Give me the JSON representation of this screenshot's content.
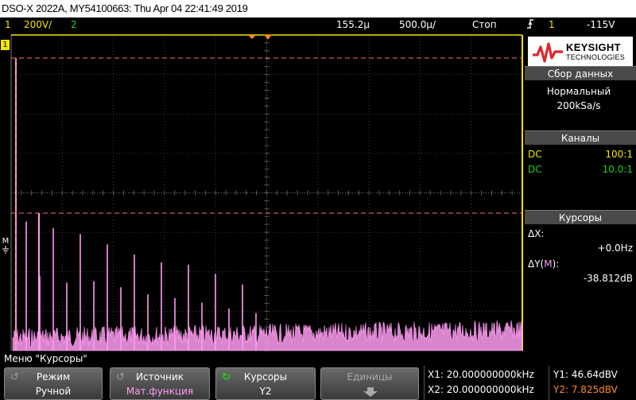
{
  "title_bar": "DSO-X 2022A, MY54100663: Thu Apr 04 22:41:49 2019",
  "status_bar": {
    "ch1_number": "1",
    "ch1_scale": "200V/",
    "ch2_number": "2",
    "time_delay": "155.2µ",
    "time_scale": "500.0µ/",
    "run_state": "Стоп",
    "trigger_icon": "trigger-edge-icon",
    "trigger_source": "1",
    "trigger_level": "-115V"
  },
  "screen_markers": {
    "top_ref": "1",
    "math_ref": "M"
  },
  "logo": {
    "brand": "KEYSIGHT",
    "sub": "TECHNOLOGIES"
  },
  "acquisition": {
    "header": "Сбор данных",
    "mode": "Нормальный",
    "rate": "200kSa/s"
  },
  "channels": {
    "header": "Каналы",
    "ch1": {
      "coupling": "DC",
      "probe": "100:1",
      "color": "#f2e600"
    },
    "ch2": {
      "coupling": "DC",
      "probe": "10.0:1",
      "color": "#22d022"
    }
  },
  "cursors_panel": {
    "header": "Курсоры",
    "dx_label": "ΔX:",
    "dx_value": "+0.0Hz",
    "dy_label_prefix": "ΔY(",
    "dy_label_m": "M",
    "dy_label_suffix": "):",
    "dy_value": "-38.812dB"
  },
  "menu_title": "Меню \"Курсоры\"",
  "softkeys": {
    "mode": {
      "label": "Режим",
      "value": "Ручной"
    },
    "source": {
      "label": "Источник",
      "value": "Мат.функция"
    },
    "cursors": {
      "label": "Курсоры",
      "value": "Y2"
    },
    "units": {
      "label": "Единицы"
    }
  },
  "cursor_readout": {
    "x1": "X1: 20.000000000kHz",
    "x2": "X2: 20.000000000kHz",
    "y1": "Y1: 46.64dBV",
    "y2": "Y2: 7.825dBV"
  },
  "colors": {
    "ch1": "#f2e600",
    "ch2": "#22d022",
    "math": "#ff9cf2",
    "cursor": "#ff7070",
    "y2_highlight": "#ff8c1a",
    "trigger_marker": "#ff8c1a",
    "panel_header": "#4a4a4a"
  }
}
